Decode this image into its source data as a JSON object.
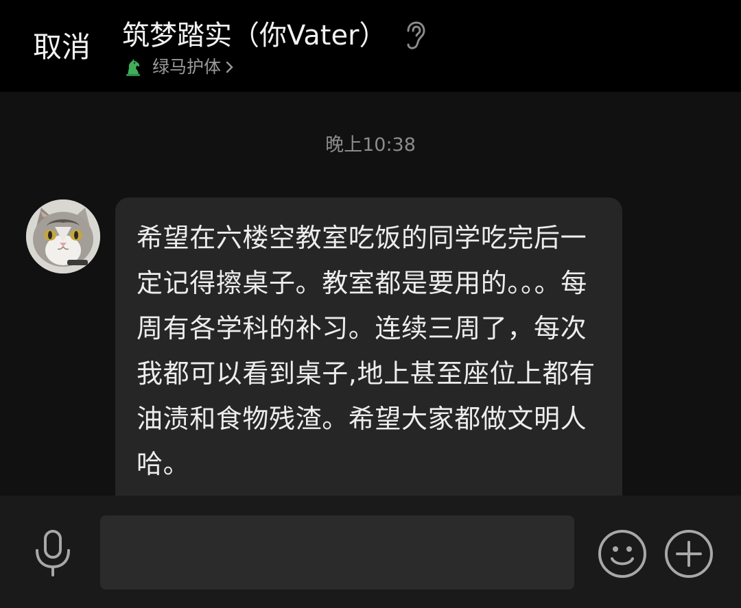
{
  "header": {
    "cancel_label": "取消",
    "title": "筑梦踏实（你Vater）",
    "subtitle": "绿马护体",
    "icons": [
      "ear-icon",
      "horse-icon",
      "chevron-right-icon"
    ]
  },
  "chat": {
    "timestamp": "晚上10:38",
    "messages": [
      {
        "sender_avatar": "cat-avatar",
        "text": "希望在六楼空教室吃饭的同学吃完后一定记得擦桌子。教室都是要用的。。。每周有各学科的补习。连续三周了，每次我都可以看到桌子,地上甚至座位上都有油渍和食物残渣。希望大家都做文明人哈。"
      }
    ]
  },
  "input_bar": {
    "value": "",
    "icons": [
      "microphone-icon",
      "emoji-icon",
      "plus-icon"
    ]
  },
  "colors": {
    "background": "#111111",
    "header": "#000000",
    "bubble": "#262626",
    "input": "#2b2b2b",
    "text": "#ededed",
    "muted": "#8c8c8c",
    "horse_green": "#3fae5b"
  }
}
